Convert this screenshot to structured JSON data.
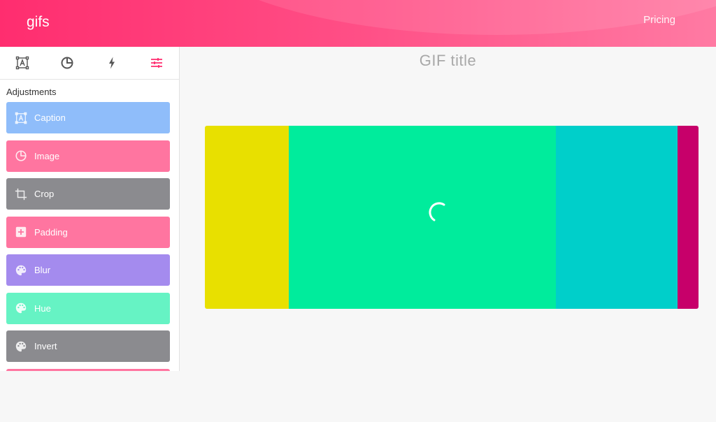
{
  "header": {
    "logo": "gifs",
    "pricing_link": "Pricing"
  },
  "sidebar": {
    "tabs": [
      {
        "icon": "caption-icon"
      },
      {
        "icon": "image-icon"
      },
      {
        "icon": "lightning-icon"
      },
      {
        "icon": "sliders-icon",
        "active": true
      }
    ],
    "section_title": "Adjustments",
    "tools": [
      {
        "label": "Caption",
        "color": "#8fbdfa",
        "icon": "caption-icon"
      },
      {
        "label": "Image",
        "color": "#ff75a0",
        "icon": "image-icon"
      },
      {
        "label": "Crop",
        "color": "#8b8b8f",
        "icon": "crop-icon"
      },
      {
        "label": "Padding",
        "color": "#ff75a0",
        "icon": "padding-icon"
      },
      {
        "label": "Blur",
        "color": "#a48bee",
        "icon": "palette-icon"
      },
      {
        "label": "Hue",
        "color": "#66f3c4",
        "icon": "palette-icon"
      },
      {
        "label": "Invert",
        "color": "#8b8b8f",
        "icon": "palette-icon"
      }
    ]
  },
  "main": {
    "gif_title": "GIF title",
    "preview_colors": [
      "#e8e000",
      "#00ec9c",
      "#00cfca",
      "#c7006a"
    ]
  },
  "colors": {
    "accent": "#ff2d6f",
    "tab_inactive": "#555555"
  }
}
